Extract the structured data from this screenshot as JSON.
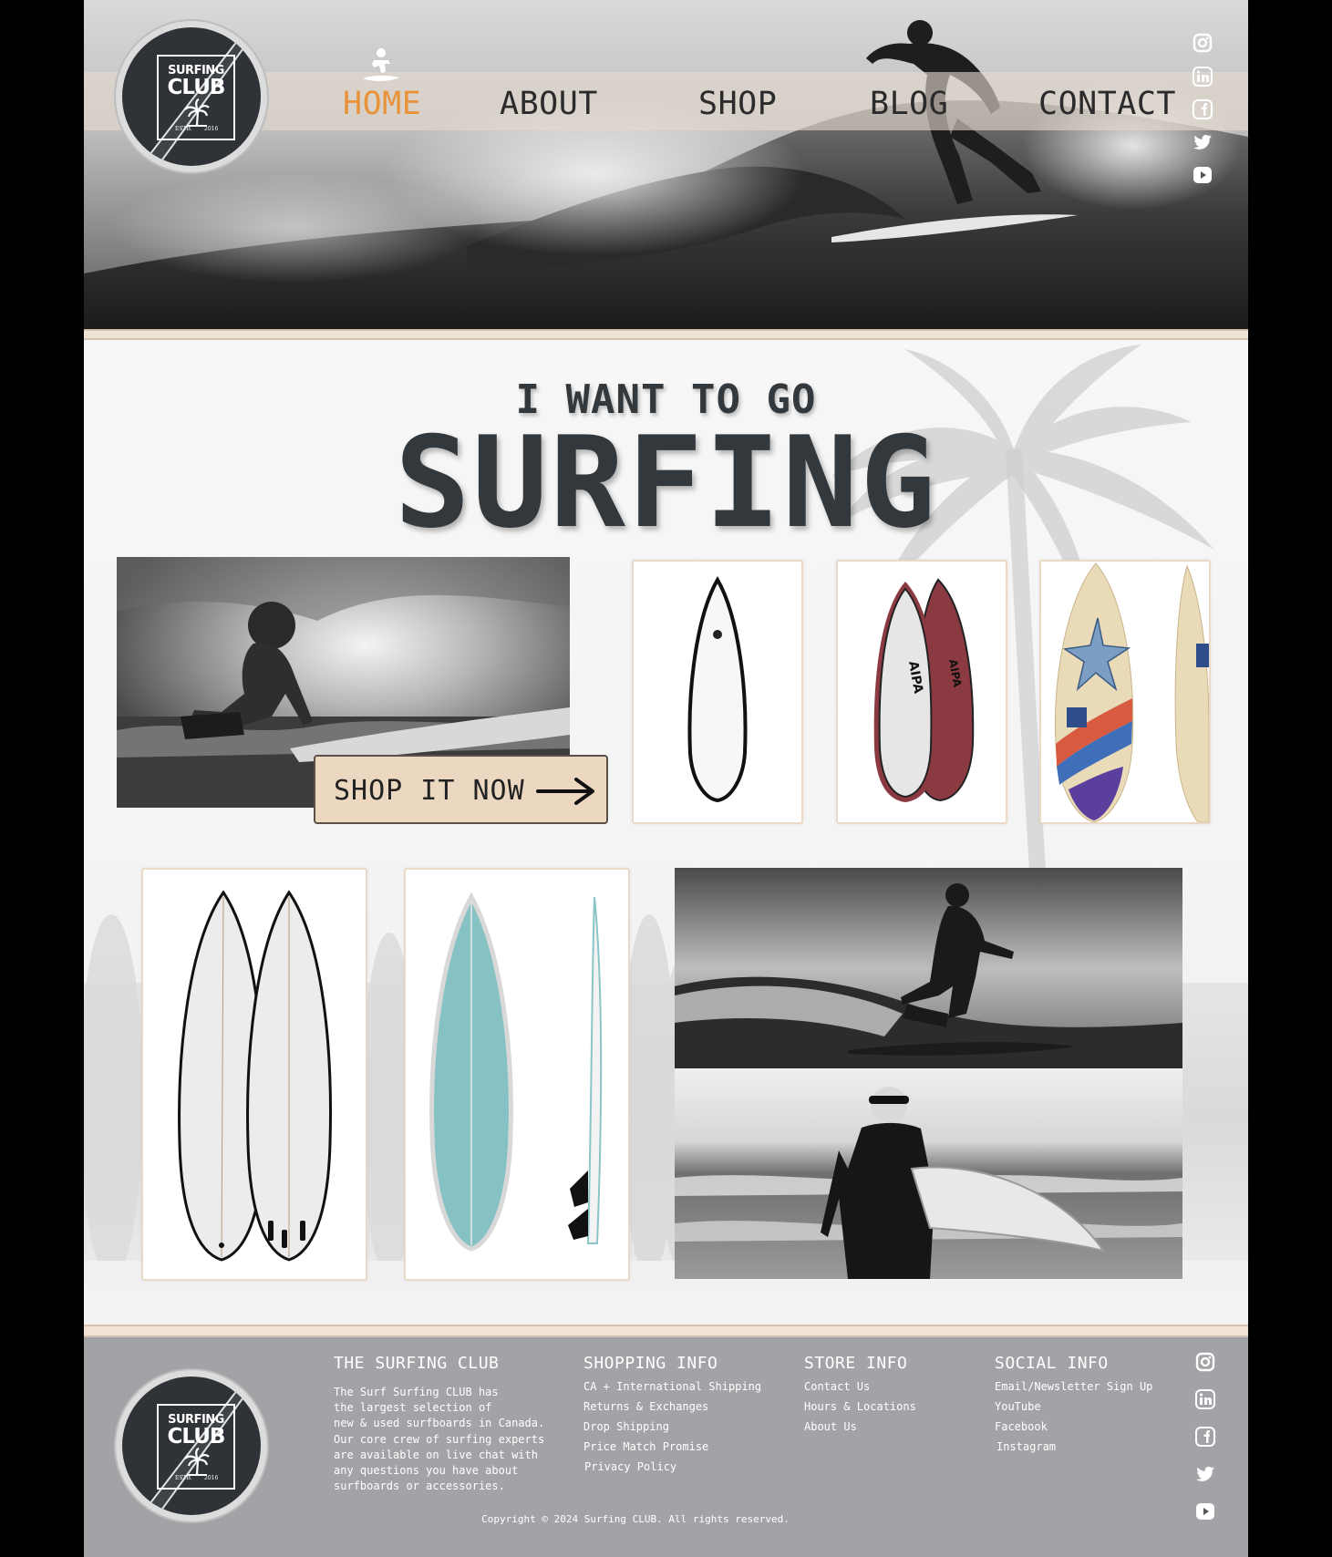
{
  "header": {
    "logo": {
      "line1": "SURFING",
      "line2": "CLUB",
      "estb": "ESTB.",
      "year": "2016"
    },
    "nav": [
      {
        "label": "HOME",
        "active": true
      },
      {
        "label": "ABOUT",
        "active": false
      },
      {
        "label": "SHOP",
        "active": false
      },
      {
        "label": "BLOG",
        "active": false
      },
      {
        "label": "CONTACT",
        "active": false
      }
    ],
    "social_icons": [
      "instagram-icon",
      "linkedin-icon",
      "facebook-icon",
      "twitter-icon",
      "youtube-icon"
    ]
  },
  "hero": {
    "headline_small": "I WANT TO GO",
    "headline_big": "SURFING",
    "cta": "SHOP IT NOW"
  },
  "footer": {
    "about": {
      "heading": "THE SURFING CLUB",
      "lines": [
        "The Surf Surfing CLUB has",
        "the largest selection of",
        "new & used surfboards in Canada.",
        "Our core crew of surfing experts",
        "are available on live chat with",
        "any questions you have about",
        "surfboards or accessories."
      ]
    },
    "shopping": {
      "heading": "SHOPPING INFO",
      "links": [
        "CA + International Shipping",
        "Returns & Exchanges",
        "Drop Shipping",
        "Price Match Promise",
        "Privacy Policy"
      ]
    },
    "store": {
      "heading": "STORE INFO",
      "links": [
        "Contact Us",
        "Hours & Locations",
        "About Us"
      ]
    },
    "social": {
      "heading": "SOCIAL INFO",
      "links": [
        "Email/Newsletter Sign Up",
        "YouTube",
        "Facebook",
        "Instagram"
      ]
    },
    "copyright": "Copyright © 2024 Surfing CLUB. All rights reserved."
  },
  "colors": {
    "accent": "#e8923a",
    "dark": "#33383d",
    "button": "#ecd8c0",
    "card_border": "#ead9c7",
    "footer_bg": "#a2a3a6"
  }
}
